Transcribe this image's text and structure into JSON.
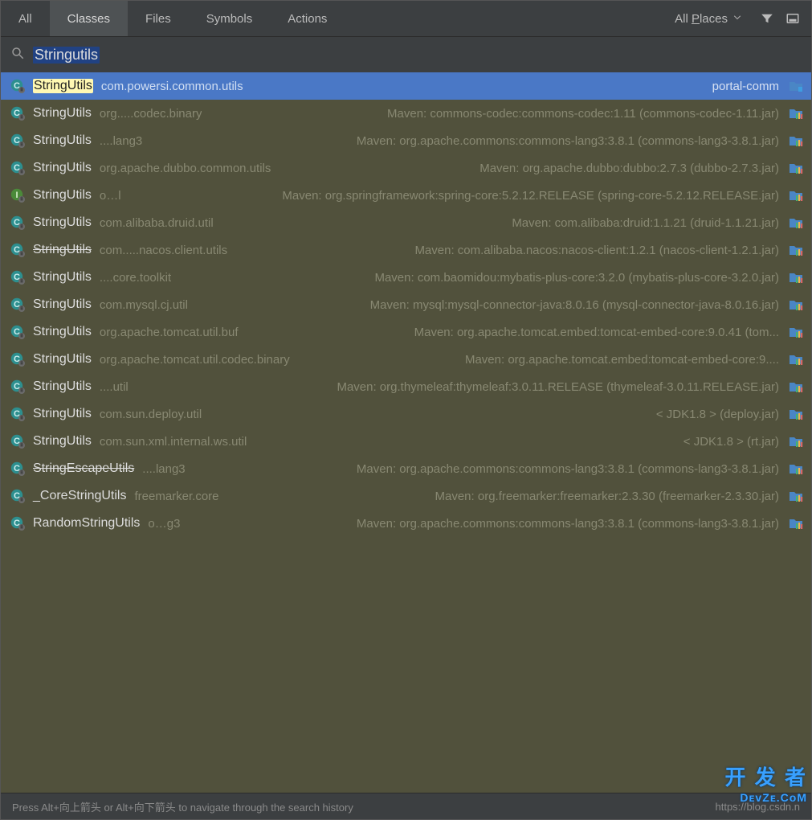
{
  "tabs": [
    {
      "label": "All",
      "underline": ""
    },
    {
      "label": "Classes",
      "underline": ""
    },
    {
      "label": "Files",
      "underline": ""
    },
    {
      "label": "Symbols",
      "underline": ""
    },
    {
      "label": "Actions",
      "underline": ""
    }
  ],
  "selected_tab": 1,
  "scope": {
    "prefix": "All ",
    "underline": "P",
    "suffix": "laces"
  },
  "search": {
    "query": "Stringutils"
  },
  "results": [
    {
      "icon": "class-lock",
      "name": "StringUtils",
      "pkg": "com.powersi.common.utils",
      "maven": "portal-comm",
      "trail": "folder",
      "selected": true,
      "strike": false
    },
    {
      "icon": "class-lock",
      "name": "StringUtils",
      "pkg": "org.....codec.binary",
      "maven": "Maven: commons-codec:commons-codec:1.11 (commons-codec-1.11.jar)",
      "trail": "lib",
      "selected": false,
      "strike": false
    },
    {
      "icon": "class-lock",
      "name": "StringUtils",
      "pkg": "....lang3",
      "maven": "Maven: org.apache.commons:commons-lang3:3.8.1 (commons-lang3-3.8.1.jar)",
      "trail": "lib",
      "selected": false,
      "strike": false
    },
    {
      "icon": "class-lock",
      "name": "StringUtils",
      "pkg": "org.apache.dubbo.common.utils",
      "maven": "Maven: org.apache.dubbo:dubbo:2.7.3 (dubbo-2.7.3.jar)",
      "trail": "lib",
      "selected": false,
      "strike": false
    },
    {
      "icon": "interface-lock",
      "name": "StringUtils",
      "pkg": "o…l",
      "maven": "Maven: org.springframework:spring-core:5.2.12.RELEASE (spring-core-5.2.12.RELEASE.jar)",
      "trail": "lib",
      "selected": false,
      "strike": false
    },
    {
      "icon": "class-lock",
      "name": "StringUtils",
      "pkg": "com.alibaba.druid.util",
      "maven": "Maven: com.alibaba:druid:1.1.21 (druid-1.1.21.jar)",
      "trail": "lib",
      "selected": false,
      "strike": false
    },
    {
      "icon": "class-lock",
      "name": "StringUtils",
      "pkg": "com.....nacos.client.utils",
      "maven": "Maven: com.alibaba.nacos:nacos-client:1.2.1 (nacos-client-1.2.1.jar)",
      "trail": "lib",
      "selected": false,
      "strike": true
    },
    {
      "icon": "class-lock",
      "name": "StringUtils",
      "pkg": "....core.toolkit",
      "maven": "Maven: com.baomidou:mybatis-plus-core:3.2.0 (mybatis-plus-core-3.2.0.jar)",
      "trail": "lib",
      "selected": false,
      "strike": false
    },
    {
      "icon": "class-lock",
      "name": "StringUtils",
      "pkg": "com.mysql.cj.util",
      "maven": "Maven: mysql:mysql-connector-java:8.0.16 (mysql-connector-java-8.0.16.jar)",
      "trail": "lib",
      "selected": false,
      "strike": false
    },
    {
      "icon": "class-lock",
      "name": "StringUtils",
      "pkg": "org.apache.tomcat.util.buf",
      "maven": "Maven: org.apache.tomcat.embed:tomcat-embed-core:9.0.41 (tom...",
      "trail": "lib",
      "selected": false,
      "strike": false
    },
    {
      "icon": "class-lock",
      "name": "StringUtils",
      "pkg": "org.apache.tomcat.util.codec.binary",
      "maven": "Maven: org.apache.tomcat.embed:tomcat-embed-core:9....",
      "trail": "lib",
      "selected": false,
      "strike": false
    },
    {
      "icon": "class-lock",
      "name": "StringUtils",
      "pkg": "....util",
      "maven": "Maven: org.thymeleaf:thymeleaf:3.0.11.RELEASE (thymeleaf-3.0.11.RELEASE.jar)",
      "trail": "lib",
      "selected": false,
      "strike": false
    },
    {
      "icon": "class-lock",
      "name": "StringUtils",
      "pkg": "com.sun.deploy.util",
      "maven": "< JDK1.8 > (deploy.jar)",
      "trail": "lib",
      "selected": false,
      "strike": false
    },
    {
      "icon": "class-lock",
      "name": "StringUtils",
      "pkg": "com.sun.xml.internal.ws.util",
      "maven": "< JDK1.8 > (rt.jar)",
      "trail": "lib",
      "selected": false,
      "strike": false
    },
    {
      "icon": "class-lock",
      "name": "StringEscapeUtils",
      "pkg": "....lang3",
      "maven": "Maven: org.apache.commons:commons-lang3:3.8.1 (commons-lang3-3.8.1.jar)",
      "trail": "lib",
      "selected": false,
      "strike": true
    },
    {
      "icon": "class-lock",
      "name": "_CoreStringUtils",
      "pkg": "freemarker.core",
      "maven": "Maven: org.freemarker:freemarker:2.3.30 (freemarker-2.3.30.jar)",
      "trail": "lib",
      "selected": false,
      "strike": false
    },
    {
      "icon": "class-lock",
      "name": "RandomStringUtils",
      "pkg": "o…g3",
      "maven": "Maven: org.apache.commons:commons-lang3:3.8.1 (commons-lang3-3.8.1.jar)",
      "trail": "lib",
      "selected": false,
      "strike": false
    }
  ],
  "footer": {
    "hint": "Press Alt+向上箭头 or Alt+向下箭头 to navigate through the search history",
    "right": "https://blog.csdn.n"
  },
  "watermark": {
    "zh": "开 发 者",
    "en": "DᴇᴠZᴇ.CᴏM"
  }
}
